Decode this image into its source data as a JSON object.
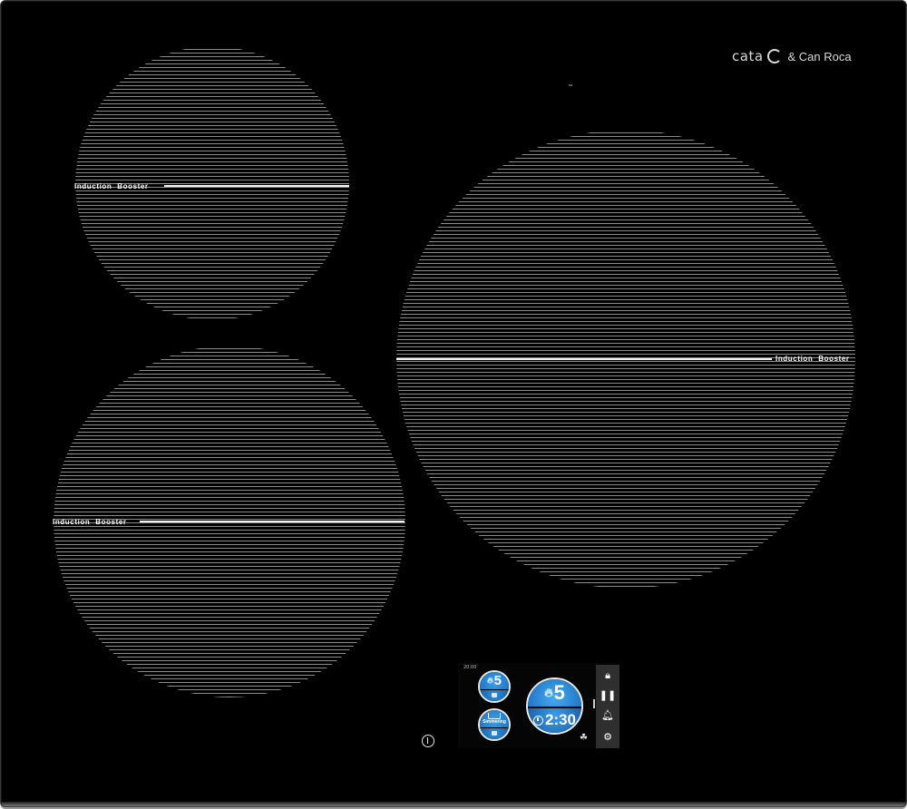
{
  "brand": {
    "name_primary": "cata",
    "name_secondary": "& Can Roca"
  },
  "zones": [
    {
      "id": "top-left",
      "label": "Induction  Booster"
    },
    {
      "id": "bottom-left",
      "label": "Induction  Booster"
    },
    {
      "id": "right",
      "label": "Induction  Booster"
    }
  ],
  "controls": {
    "clock": "20:00",
    "zone_small_1": {
      "power_level": "5"
    },
    "zone_small_2": {
      "mode_label": "Simmering"
    },
    "zone_main": {
      "power_level": "5",
      "timer": "2:30"
    },
    "side_icons": {
      "lock": "lock-icon",
      "pause": "pause-icon",
      "bell": "bell-icon",
      "settings": "gear-icon"
    }
  },
  "colors": {
    "glass": "#000000",
    "zone_lines": "#8c8c8c",
    "display_blue": "#2a8ae0",
    "side_bar": "#2f2f2f"
  }
}
